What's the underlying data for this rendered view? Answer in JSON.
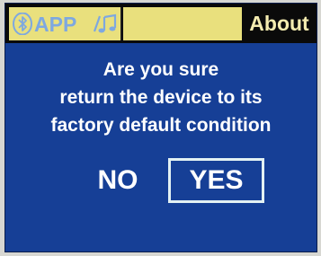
{
  "header": {
    "tabs": [
      {
        "label": "APP",
        "active": false
      },
      {
        "label": "",
        "active": false
      },
      {
        "label": "About",
        "active": true
      }
    ],
    "icons": [
      "bluetooth-icon",
      "music-note-icon"
    ]
  },
  "dialog": {
    "lines": [
      "Are you sure",
      "return the device to its",
      "factory default condition"
    ],
    "no_label": "NO",
    "yes_label": "YES",
    "selected": "YES"
  },
  "colors": {
    "screen_bg": "#163f96",
    "tab_bg": "#e9e07d",
    "topbar_bg": "#0a0a0a",
    "about_text": "#f4ecb0",
    "app_text": "#7ea8e0"
  }
}
